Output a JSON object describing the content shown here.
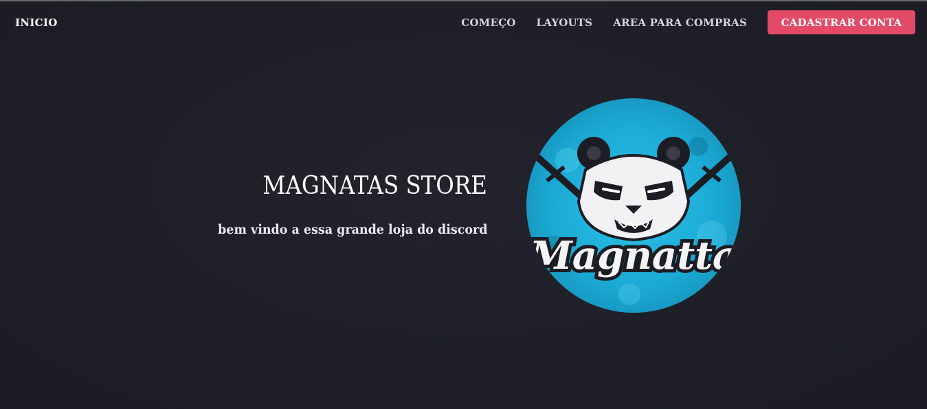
{
  "nav": {
    "brand": "INICIO",
    "links": [
      "COMEÇO",
      "LAYOUTS",
      "AREA PARA COMPRAS"
    ],
    "cta_label": "CADASTRAR CONTA"
  },
  "hero": {
    "title": "MAGNATAS STORE",
    "subtitle": "bem vindo a essa grande loja do discord",
    "logo_text": "Magnatta"
  },
  "colors": {
    "background": "#1e1f27",
    "accent": "#e24a68",
    "logo_blue": "#1aa9d4"
  },
  "icons": {
    "logo": "panda-mascot-icon"
  }
}
